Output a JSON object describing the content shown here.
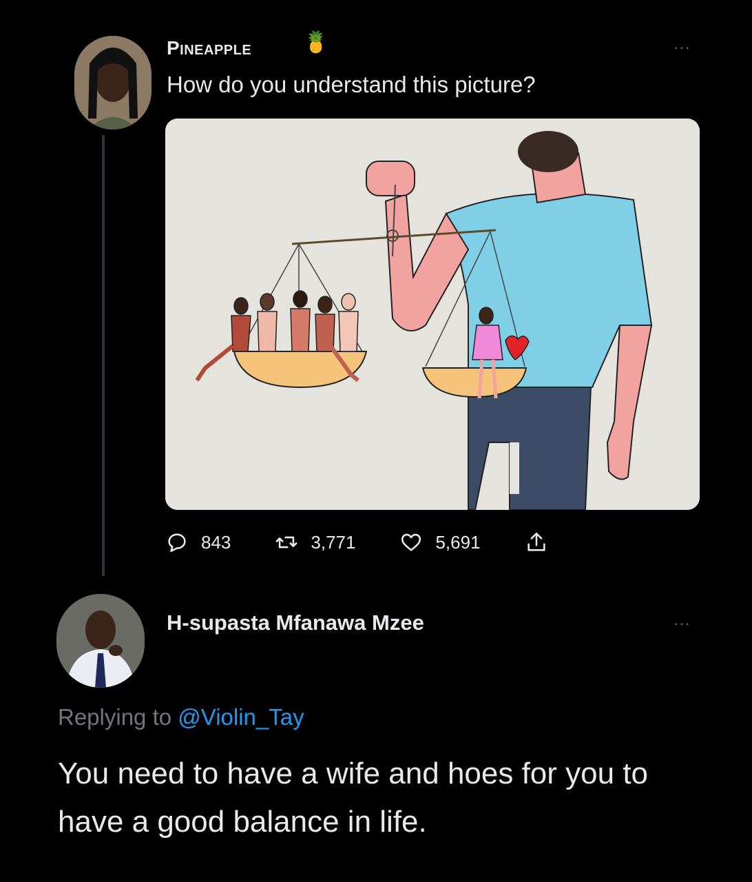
{
  "tweet": {
    "author_name": "Pineapple",
    "author_emoji": "🍍",
    "text": "How do you understand this picture?",
    "more": "···",
    "stats": {
      "replies": "843",
      "retweets": "3,771",
      "likes": "5,691"
    }
  },
  "reply": {
    "author_name": "H-supasta Mfanawa Mzee",
    "more": "···",
    "replying_label": "Replying to",
    "replying_handle": "@Violin_Tay",
    "text": "You need to have a wife and hoes for you to have a good balance in life."
  },
  "colors": {
    "background": "#000000",
    "text": "#e7e9ea",
    "secondary": "#71767b",
    "link": "#1d9bf0",
    "shirt": "#7fd0e6",
    "skin": "#f2a3a0",
    "pants": "#3c4c66",
    "scale_pan": "#f6c37a"
  }
}
